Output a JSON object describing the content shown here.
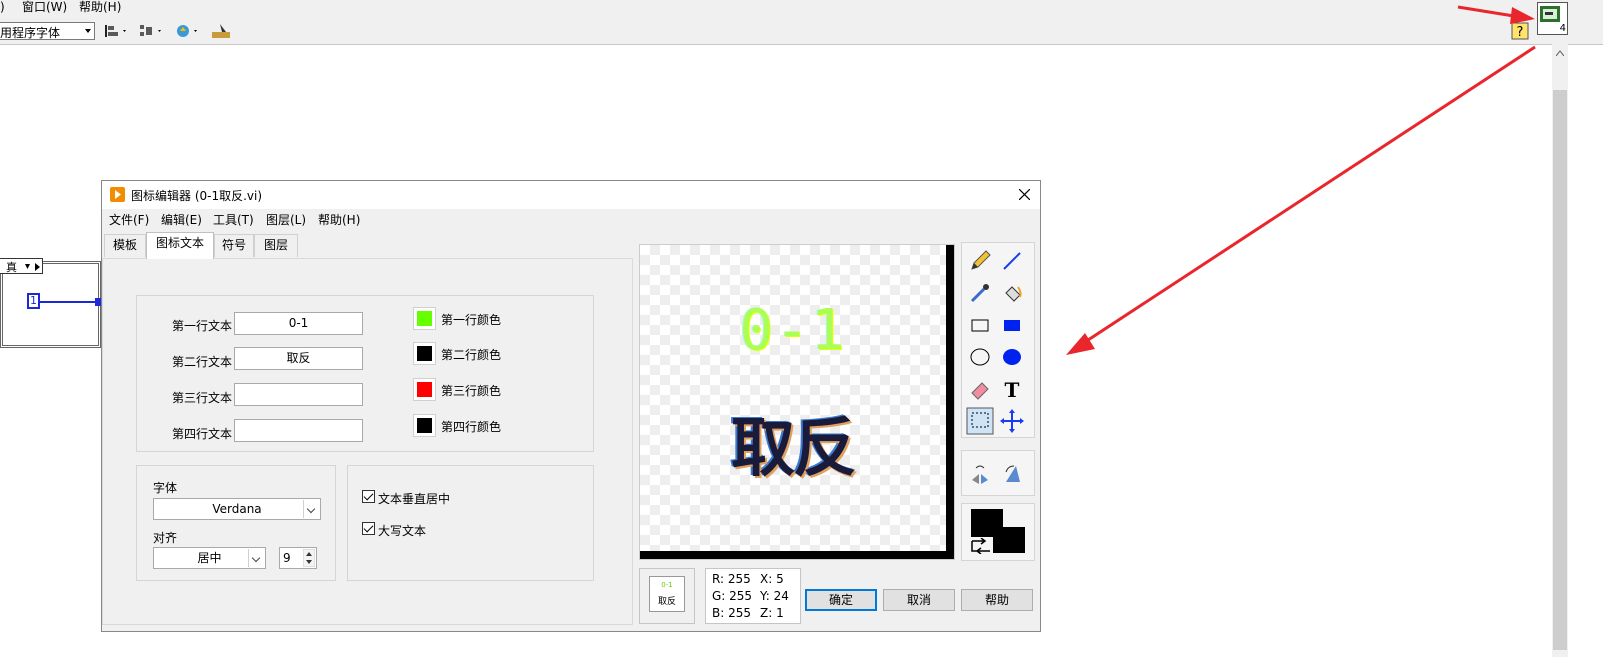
{
  "app_menu": {
    "item_partial": ")",
    "window": "窗口(W)",
    "help": "帮助(H)"
  },
  "app_toolbar": {
    "font_select": "用程序字体"
  },
  "block_diagram": {
    "selector_value": "真",
    "constant_value": "1"
  },
  "connector_pane": {
    "count": "4"
  },
  "dialog": {
    "title": "图标编辑器 (0-1取反.vi)",
    "menu": [
      "文件(F)",
      "编辑(E)",
      "工具(T)",
      "图层(L)",
      "帮助(H)"
    ],
    "tabs": [
      "模板",
      "图标文本",
      "符号",
      "图层"
    ],
    "active_tab": "图标文本",
    "lines": [
      {
        "label": "第一行文本",
        "value": "0-1",
        "color_label": "第一行颜色",
        "color": "#66ff00"
      },
      {
        "label": "第二行文本",
        "value": "取反",
        "color_label": "第二行颜色",
        "color": "#000000"
      },
      {
        "label": "第三行文本",
        "value": "",
        "color_label": "第三行颜色",
        "color": "#ff0000"
      },
      {
        "label": "第四行文本",
        "value": "",
        "color_label": "第四行颜色",
        "color": "#000000"
      }
    ],
    "font_label": "字体",
    "font_value": "Verdana",
    "align_label": "对齐",
    "align_value": "居中",
    "size_value": "9",
    "check_vcenter": "文本垂直居中",
    "check_uppercase": "大写文本",
    "preview_line1": "0-1",
    "preview_line2": "取反",
    "readout": {
      "r": "R: 255",
      "g": "G: 255",
      "b": "B: 255",
      "x": "X: 5",
      "y": "Y: 24",
      "z": "Z: 1"
    },
    "buttons": {
      "ok": "确定",
      "cancel": "取消",
      "help": "帮助"
    }
  },
  "colors": {
    "annotation_arrow": "#e8262b",
    "accent": "#0078d7"
  }
}
